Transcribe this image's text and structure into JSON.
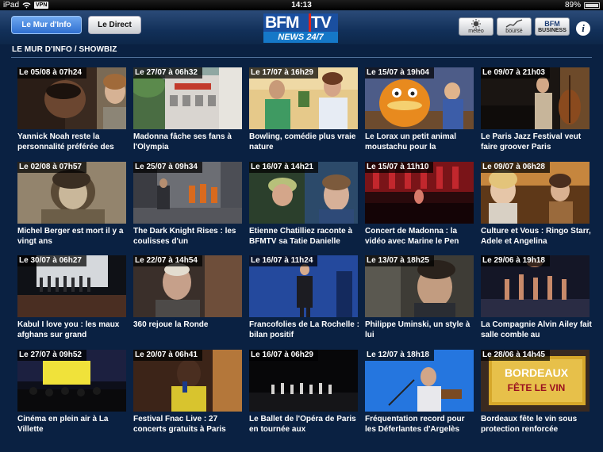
{
  "statusbar": {
    "device": "iPad",
    "vpn": "VPN",
    "time": "14:13",
    "battery": "89%"
  },
  "header": {
    "tabs": [
      {
        "label": "Le Mur d'Info",
        "active": true
      },
      {
        "label": "Le Direct",
        "active": false
      }
    ],
    "logo": {
      "top": "BFMTV",
      "bfm": "BFM",
      "tv": "TV",
      "bottom": "NEWS 24/7"
    },
    "buttons": {
      "meteo": "météo",
      "bourse": "bourse",
      "business_logo": "BFM",
      "business": "BUSINESS"
    },
    "info": "i"
  },
  "section": {
    "title": "LE MUR D'INFO / SHOWBIZ"
  },
  "colors": {
    "background": "#0a2142",
    "active_tab": "#2f6fd0",
    "logo_blue": "#1a4fa0",
    "logo_red": "#e0231c"
  },
  "articles": [
    {
      "date": "Le 05/08 à 07h24",
      "title": "Yannick Noah reste la personnalité préférée des"
    },
    {
      "date": "Le 27/07 à 06h32",
      "title": "Madonna fâche ses fans à l'Olympia"
    },
    {
      "date": "Le 17/07 à 16h29",
      "title": "Bowling, comédie plus vraie nature"
    },
    {
      "date": "Le 15/07 à 19h04",
      "title": "Le Lorax un petit animal moustachu pour la"
    },
    {
      "date": "Le 09/07 à 21h03",
      "title": "Le Paris Jazz Festival veut faire groover Paris"
    },
    {
      "date": "Le 02/08 à 07h57",
      "title": "Michel Berger est mort il y a vingt ans"
    },
    {
      "date": "Le 25/07 à 09h34",
      "title": "The Dark Knight Rises : les coulisses d'un"
    },
    {
      "date": "Le 16/07 à 14h21",
      "title": "Etienne Chatilliez raconte à BFMTV sa Tatie Danielle"
    },
    {
      "date": "Le 15/07 à 11h10",
      "title": "Concert de Madonna : la vidéo avec Marine le Pen"
    },
    {
      "date": "Le 09/07 à 06h28",
      "title": "Culture et Vous : Ringo Starr, Adele et Angelina"
    },
    {
      "date": "Le 30/07 à 06h27",
      "title": "Kabul I love you :  les maux afghans sur grand"
    },
    {
      "date": "Le 22/07 à 14h54",
      "title": "360 rejoue la Ronde"
    },
    {
      "date": "Le 16/07 à 11h24",
      "title": "Francofolies de La Rochelle : bilan positif"
    },
    {
      "date": "Le 13/07 à 18h25",
      "title": "Philippe Uminski, un style à lui"
    },
    {
      "date": "Le 29/06 à 19h18",
      "title": "La Compagnie Alvin Ailey fait salle comble au"
    },
    {
      "date": "Le 27/07 à 09h52",
      "title": "Cinéma en plein air à La Villette"
    },
    {
      "date": "Le 20/07 à 06h41",
      "title": "Festival Fnac Live : 27 concerts gratuits à Paris"
    },
    {
      "date": "Le 16/07 à 06h29",
      "title": "Le Ballet de l'Opéra de Paris en tournée aux"
    },
    {
      "date": "Le 12/07 à 18h18",
      "title": "Fréquentation record pour les Déferlantes d'Argelès"
    },
    {
      "date": "Le 28/06 à 14h45",
      "title": "Bordeaux fête le vin sous protection renforcée"
    }
  ],
  "thumb_texts": {
    "bordeaux_line1": "BORDEAUX",
    "bordeaux_line2": "FÊTE LE VIN"
  }
}
